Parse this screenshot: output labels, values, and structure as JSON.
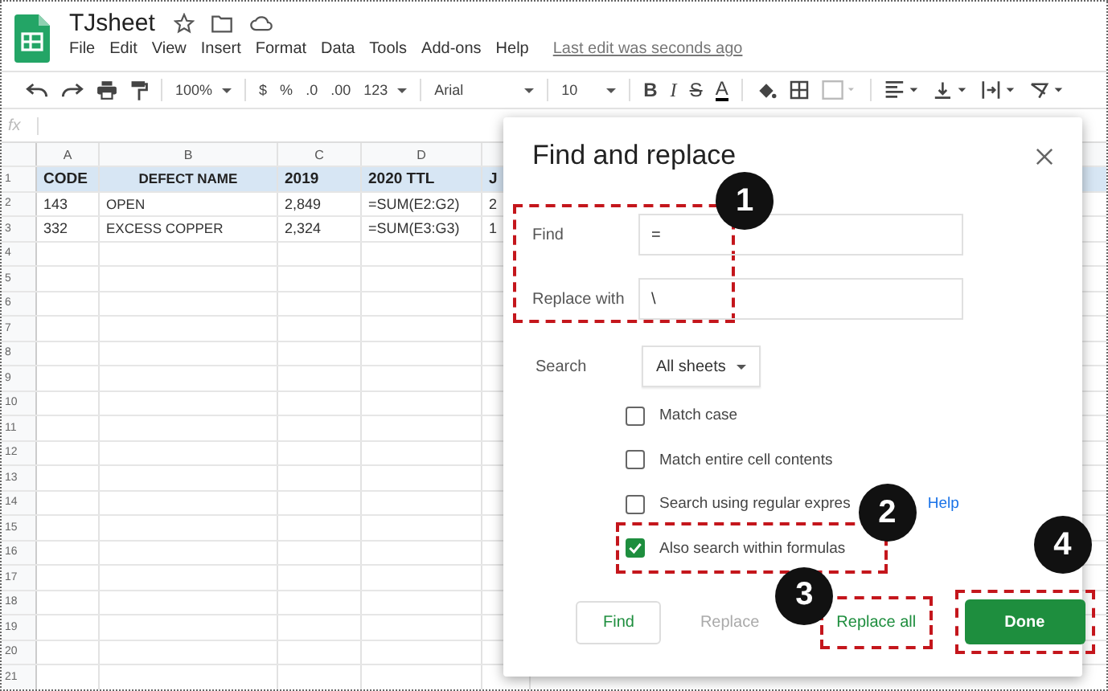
{
  "app": {
    "title": "TJsheet",
    "menu": [
      "File",
      "Edit",
      "View",
      "Insert",
      "Format",
      "Data",
      "Tools",
      "Add-ons",
      "Help"
    ],
    "last_edit": "Last edit was seconds ago"
  },
  "toolbar": {
    "zoom": "100%",
    "currency": "$",
    "percent": "%",
    "decimal_decrease": ".0",
    "decimal_increase": ".00",
    "number_format": "123",
    "font": "Arial",
    "font_size": "10",
    "bold": "B",
    "italic": "I",
    "strikethrough": "S",
    "text_color": "A"
  },
  "formula_bar": {
    "label": "fx"
  },
  "sheet": {
    "columns": [
      "A",
      "B",
      "C",
      "D"
    ],
    "rows": [
      {
        "number": "1",
        "kind": "header",
        "cells": [
          "CODE",
          "DEFECT NAME",
          "2019",
          "2020 TTL",
          "J"
        ]
      },
      {
        "number": "2",
        "kind": "data",
        "cells": [
          "143",
          "OPEN",
          "2,849",
          "=SUM(E2:G2)",
          "2"
        ]
      },
      {
        "number": "3",
        "kind": "data",
        "cells": [
          "332",
          "EXCESS COPPER",
          "2,324",
          "=SUM(E3:G3)",
          "1"
        ]
      },
      {
        "number": "4",
        "kind": "data",
        "cells": []
      },
      {
        "number": "5",
        "kind": "data",
        "cells": []
      },
      {
        "number": "6",
        "kind": "data",
        "cells": []
      },
      {
        "number": "7",
        "kind": "data",
        "cells": []
      },
      {
        "number": "8",
        "kind": "data",
        "cells": []
      },
      {
        "number": "9",
        "kind": "data",
        "cells": []
      },
      {
        "number": "10",
        "kind": "data",
        "cells": []
      },
      {
        "number": "11",
        "kind": "data",
        "cells": []
      },
      {
        "number": "12",
        "kind": "data",
        "cells": []
      },
      {
        "number": "13",
        "kind": "data",
        "cells": []
      },
      {
        "number": "14",
        "kind": "data",
        "cells": []
      },
      {
        "number": "15",
        "kind": "data",
        "cells": []
      },
      {
        "number": "16",
        "kind": "data",
        "cells": []
      },
      {
        "number": "17",
        "kind": "data",
        "cells": []
      },
      {
        "number": "18",
        "kind": "data",
        "cells": []
      },
      {
        "number": "19",
        "kind": "data",
        "cells": []
      },
      {
        "number": "20",
        "kind": "data",
        "cells": []
      },
      {
        "number": "21",
        "kind": "data",
        "cells": []
      }
    ]
  },
  "dialog": {
    "title": "Find and replace",
    "fields_callout": "1",
    "fields": [
      {
        "label": "Find",
        "value": "="
      },
      {
        "label": "Replace with",
        "value": "\\"
      }
    ],
    "search": {
      "label": "Search",
      "value": "All sheets"
    },
    "options": [
      {
        "label": "Match case",
        "checked": false
      },
      {
        "label": "Match entire cell contents",
        "checked": false
      },
      {
        "label": "Search using regular expres",
        "checked": false
      },
      {
        "label": "Also search within formulas",
        "checked": true,
        "callout": "2"
      }
    ],
    "help_link": "Help",
    "buttons": [
      {
        "label": "Find",
        "kind": "outlined"
      },
      {
        "label": "Replace",
        "kind": "disabled"
      },
      {
        "label": "Replace all",
        "kind": "text",
        "callout": "3"
      },
      {
        "label": "Done",
        "kind": "primary",
        "callout": "4"
      }
    ]
  }
}
